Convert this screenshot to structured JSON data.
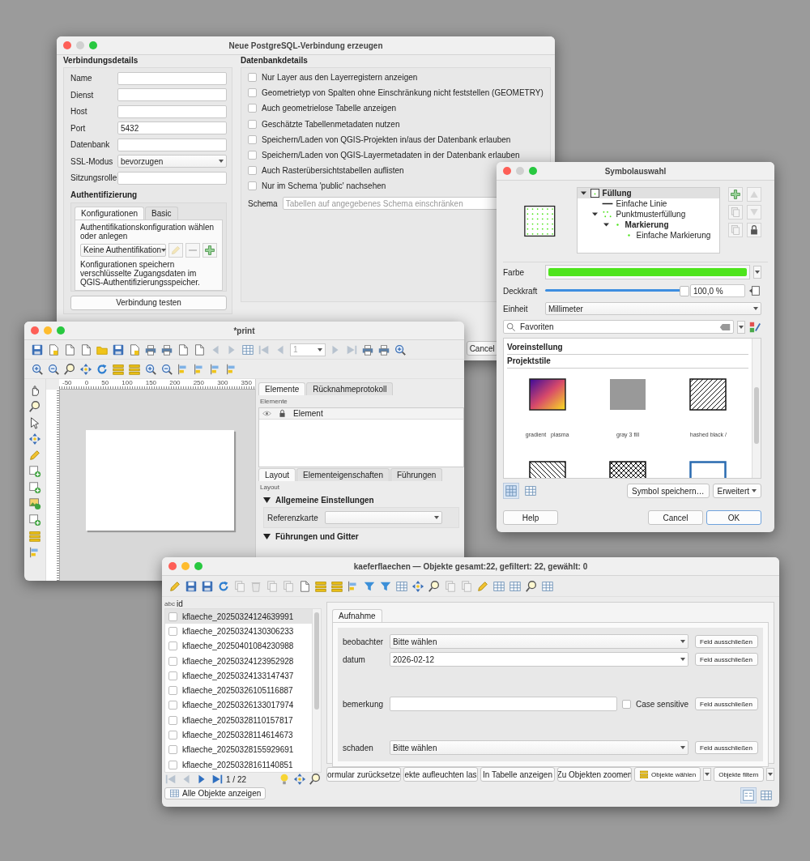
{
  "connection_dialog": {
    "title": "Neue PostgreSQL-Verbindung erzeugen",
    "details_heading": "Verbindungsdetails",
    "fields": [
      {
        "label": "Name",
        "kind": "text"
      },
      {
        "label": "Dienst",
        "kind": "text"
      },
      {
        "label": "Host",
        "kind": "text"
      },
      {
        "label": "Port",
        "kind": "text",
        "value": "5432"
      },
      {
        "label": "Datenbank",
        "kind": "text"
      },
      {
        "label": "SSL-Modus",
        "kind": "select",
        "value": "bevorzugen"
      },
      {
        "label": "Sitzungsrolle",
        "kind": "text"
      }
    ],
    "auth_heading": "Authentifizierung",
    "auth_tabs": [
      {
        "label": "Konfigurationen",
        "selected": true
      },
      {
        "label": "Basic",
        "selected": false
      }
    ],
    "auth_hint": "Authentifikationskonfiguration wählen oder anlegen",
    "auth_select": "Keine Authentifikation",
    "auth_note": "Konfigurationen speichern verschlüsselte Zugangsdaten im QGIS-Authentifizierungsspeicher.",
    "test_button": "Verbindung testen",
    "db_heading": "Datenbankdetails",
    "options": [
      {
        "label": "Nur Layer aus den Layerregistern anzeigen",
        "checked": false
      },
      {
        "label": "Geometrietyp von Spalten ohne Einschränkung nicht feststellen (GEOMETRY)",
        "checked": false
      },
      {
        "label": "Auch geometrielose Tabelle anzeigen",
        "checked": false
      },
      {
        "label": "Geschätzte Tabellenmetadaten nutzen",
        "checked": false
      },
      {
        "label": "Speichern/Laden von QGIS-Projekten in/aus der Datenbank erlauben",
        "checked": false
      },
      {
        "label": "Speichern/Laden von QGIS-Layermetadaten in der Datenbank erlauben",
        "checked": false
      },
      {
        "label": "Auch Rasterübersichtstabellen auflisten",
        "checked": false
      },
      {
        "label": "Nur im Schema 'public' nachsehen",
        "checked": false
      }
    ],
    "schema": {
      "label": "Schema",
      "placeholder": "Tabellen auf angegebenes Schema einschränken"
    },
    "cancel_button": "Cancel"
  },
  "print_layout": {
    "title": "*print",
    "page_field": "1",
    "ruler_labels": [
      "-50",
      "0",
      "50",
      "100",
      "150",
      "200",
      "250",
      "300",
      "350"
    ],
    "top_tabs": [
      {
        "label": "Elemente",
        "selected": true
      },
      {
        "label": "Rücknahmeprotokoll",
        "selected": false
      }
    ],
    "elements_panel_title": "Elemente",
    "elements_column": "Element",
    "bottom_tabs": [
      {
        "label": "Layout",
        "selected": true
      },
      {
        "label": "Elementeigenschaften",
        "selected": false
      },
      {
        "label": "Führungen",
        "selected": false
      }
    ],
    "layout_panel_title": "Layout",
    "sections": [
      {
        "title": "Allgemeine Einstellungen",
        "expanded": true
      },
      {
        "title": "Führungen und Gitter",
        "expanded": true
      }
    ],
    "reference_map_label": "Referenzkarte"
  },
  "symbol_selector": {
    "title": "Symbolauswahl",
    "tree": [
      {
        "label": "Füllung",
        "kind": "fill",
        "bold": true,
        "selected": true,
        "expanded": true,
        "children": [
          {
            "label": "Einfache Linie",
            "kind": "line",
            "bold": false,
            "selected": false
          },
          {
            "label": "Punktmusterfüllung",
            "kind": "pattern",
            "bold": false,
            "selected": false,
            "expanded": true,
            "children": [
              {
                "label": "Markierung",
                "kind": "marker",
                "bold": true,
                "selected": false,
                "expanded": true,
                "children": [
                  {
                    "label": "Einfache Markierung",
                    "kind": "marker",
                    "bold": false,
                    "selected": false
                  }
                ]
              }
            ]
          }
        ]
      }
    ],
    "color_label": "Farbe",
    "opacity": {
      "label": "Deckkraft",
      "level": 0.98,
      "reading": "100,0 %"
    },
    "unit": {
      "label": "Einheit",
      "value": "Millimeter"
    },
    "search": {
      "value": "Favoriten"
    },
    "groups": [
      "Voreinstellung",
      "Projektstile"
    ],
    "styles": [
      {
        "kind": "gradient",
        "label": "gradient   plasma"
      },
      {
        "kind": "solid",
        "label": "gray 3 fill"
      },
      {
        "kind": "hatch",
        "label": "hashed black /"
      },
      {
        "kind": "backhatch"
      },
      {
        "kind": "crosshatch"
      },
      {
        "kind": "outline"
      }
    ],
    "view_modes": [
      {
        "kind": "icons",
        "selected": true
      },
      {
        "kind": "list",
        "selected": false
      }
    ],
    "save_button": "Symbol speichern…",
    "advanced_button": "Erweitert",
    "help_button": "Help",
    "cancel_button": "Cancel",
    "ok_button": "OK"
  },
  "attribute_table": {
    "title": "kaeferflaechen — Objekte gesamt:22, gefiltert: 22, gewählt: 0",
    "column_type": "abc",
    "column_header": "id",
    "features": [
      {
        "label": "kflaeche_20250324124639991",
        "selected": true,
        "checked": false
      },
      {
        "label": "kflaeche_20250324130306233",
        "selected": false,
        "checked": false
      },
      {
        "label": "kflaeche_20250401084230988",
        "selected": false,
        "checked": false
      },
      {
        "label": "kflaeche_20250324123952928",
        "selected": false,
        "checked": false
      },
      {
        "label": "kflaeche_20250324133147437",
        "selected": false,
        "checked": false
      },
      {
        "label": "kflaeche_20250326105116887",
        "selected": false,
        "checked": false
      },
      {
        "label": "kflaeche_20250326133017974",
        "selected": false,
        "checked": false
      },
      {
        "label": "kflaeche_20250328110157817",
        "selected": false,
        "checked": false
      },
      {
        "label": "kflaeche_20250328114614673",
        "selected": false,
        "checked": false
      },
      {
        "label": "kflaeche_20250328155929691",
        "selected": false,
        "checked": false
      },
      {
        "label": "kflaeche_20250328161140851",
        "selected": false,
        "checked": false
      }
    ],
    "nav_position": "1 / 22",
    "show_all_button": "Alle Objekte anzeigen",
    "tabs": [
      {
        "label": "Aufnahme",
        "selected": true
      }
    ],
    "form_fields": [
      {
        "label": "beobachter",
        "kind": "select",
        "value": "Bitte wählen",
        "exclude_button": "Feld ausschließen"
      },
      {
        "label": "datum",
        "kind": "date",
        "value": "2026-02-12",
        "exclude_button": "Feld ausschließen"
      },
      {
        "label": "bemerkung",
        "kind": "text",
        "case_label": "Case sensitive",
        "case_checked": false,
        "exclude_button": "Feld ausschließen"
      },
      {
        "label": "schaden",
        "kind": "select",
        "value": "Bitte wählen",
        "exclude_button": "Feld ausschließen"
      }
    ],
    "action_buttons": [
      "ormular zurücksetze",
      "ekte aufleuchten las",
      "In Tabelle anzeigen",
      "Zu Objekten zoomen"
    ],
    "select_button": "Objekte wählen",
    "filter_button": "Objekte filtern",
    "view_modes": [
      {
        "kind": "form",
        "selected": true
      },
      {
        "kind": "table",
        "selected": false
      }
    ]
  }
}
